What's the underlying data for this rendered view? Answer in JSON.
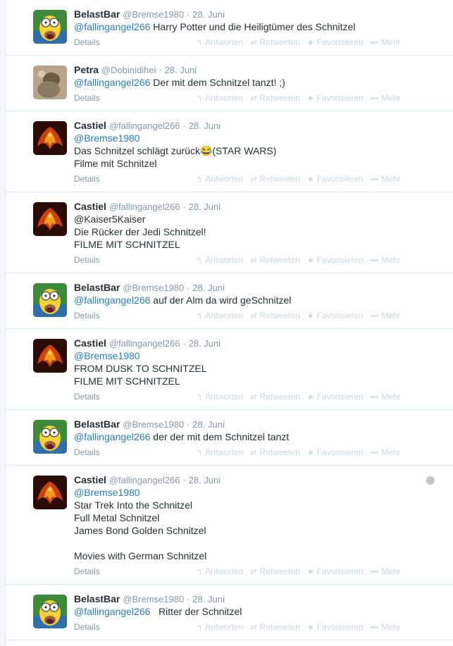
{
  "actions": {
    "reply": "Antworten",
    "retweet": "Retweeten",
    "favorite": "Favorisieren",
    "more": "Mehr",
    "details": "Details"
  },
  "separator": "·",
  "tweets": [
    {
      "name": "BelastBar",
      "handle": "@Bremse1980",
      "date": "28. Juni",
      "avatar": "homer",
      "lines": [
        [
          "@fallingangel266",
          " Harry Potter und die Heiligtümer des Schnitzel"
        ]
      ]
    },
    {
      "name": "Petra",
      "handle": "@Dobinidihei",
      "date": "28. Juni",
      "avatar": "photo",
      "lines": [
        [
          "@fallingangel266",
          " Der mit dem Schnitzel tanzt! ;)"
        ]
      ]
    },
    {
      "name": "Castiel",
      "handle": "@fallingangel266",
      "date": "28. Juni",
      "avatar": "phoenix",
      "lines": [
        [
          "@Bremse1980",
          ""
        ],
        [
          "",
          "Das Schnitzel schlägt zurück😂(STAR WARS)"
        ],
        [
          "",
          "Filme mit Schnitzel"
        ]
      ]
    },
    {
      "name": "Castiel",
      "handle": "@fallingangel266",
      "date": "28. Juni",
      "avatar": "phoenix",
      "lines": [
        [
          "",
          "@Kaiser5Kaiser"
        ],
        [
          "",
          "Die Rücker der Jedi Schnitzel!"
        ],
        [
          "",
          "FILME MIT SCHNITZEL"
        ]
      ]
    },
    {
      "name": "BelastBar",
      "handle": "@Bremse1980",
      "date": "28. Juni",
      "avatar": "homer",
      "lines": [
        [
          "@fallingangel266",
          " auf der Alm da wird geSchnitzel"
        ]
      ]
    },
    {
      "name": "Castiel",
      "handle": "@fallingangel266",
      "date": "28. Juni",
      "avatar": "phoenix",
      "lines": [
        [
          "@Bremse1980",
          ""
        ],
        [
          "",
          "FROM DUSK TO SCHNITZEL"
        ],
        [
          "",
          "FILME MIT SCHNITZEL"
        ]
      ]
    },
    {
      "name": "BelastBar",
      "handle": "@Bremse1980",
      "date": "28. Juni",
      "avatar": "homer",
      "lines": [
        [
          "@fallingangel266",
          " der der mit dem Schnitzel tanzt"
        ]
      ]
    },
    {
      "name": "Castiel",
      "handle": "@fallingangel266",
      "date": "28. Juni",
      "avatar": "phoenix",
      "globe": true,
      "lines": [
        [
          "@Bremse1980",
          ""
        ],
        [
          "",
          "Star Trek Into the Schnitzel"
        ],
        [
          "",
          "Full Metal Schnitzel"
        ],
        [
          "",
          "James Bond Golden Schnitzel"
        ],
        [
          "",
          ""
        ],
        [
          "",
          "Movies with German Schnitzel"
        ]
      ]
    },
    {
      "name": "BelastBar",
      "handle": "@Bremse1980",
      "date": "28. Juni",
      "avatar": "homer",
      "lines": [
        [
          "@fallingangel266",
          "   Ritter der Schnitzel"
        ]
      ]
    }
  ]
}
